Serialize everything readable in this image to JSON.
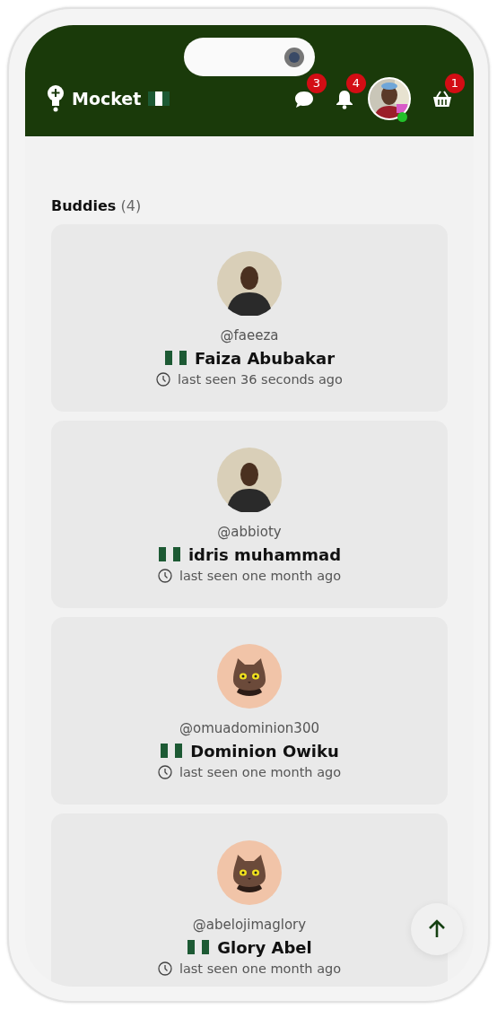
{
  "header": {
    "brand": "Mocket",
    "messages_badge": "3",
    "notifications_badge": "4",
    "profile_online": true,
    "cart_badge": "1"
  },
  "buddies": {
    "title": "Buddies",
    "count": "(4)",
    "items": [
      {
        "handle": "@faeeza",
        "name": "Faiza Abubakar",
        "last_seen": "last seen 36 seconds ago"
      },
      {
        "handle": "@abbioty",
        "name": "idris muhammad",
        "last_seen": "last seen one month ago"
      },
      {
        "kind": "cat",
        "handle": "@omuadominion300",
        "name": "Dominion Owiku",
        "last_seen": "last seen one month ago"
      },
      {
        "kind": "cat",
        "handle": "@abelojimaglory",
        "name": "Glory Abel",
        "last_seen": "last seen one month ago"
      }
    ]
  }
}
